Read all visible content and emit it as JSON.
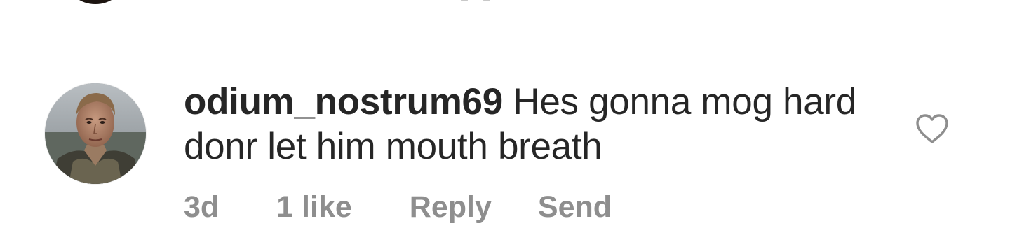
{
  "comment": {
    "username": "odium_nostrum69",
    "text": "Hes gonna mog hard donr let him mouth breath",
    "time": "3d",
    "likes": "1 like",
    "reply_label": "Reply",
    "send_label": "Send",
    "like_icon": "heart-outline-icon"
  },
  "colors": {
    "text_primary": "#262626",
    "text_secondary": "#8e8e8e",
    "icon": "#8e8e8e",
    "background": "#ffffff"
  }
}
